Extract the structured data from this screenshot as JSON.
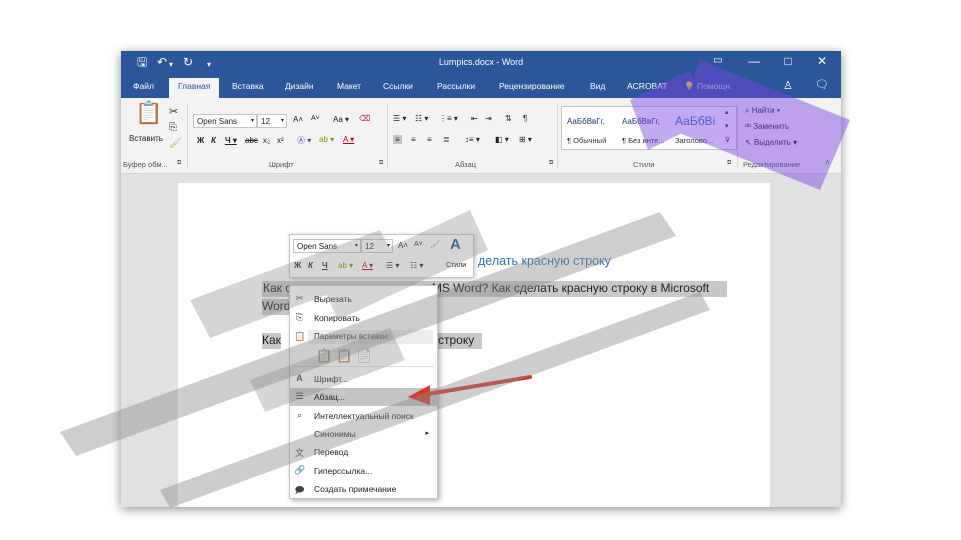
{
  "window": {
    "title": "Lumpics.docx - Word",
    "icons": {
      "save": "save-icon",
      "undo": "undo-icon",
      "redo": "redo-icon",
      "customize": "customize-icon"
    },
    "controls": {
      "ribbon_options": "▭",
      "minimize": "—",
      "maximize": "□",
      "close": "✕"
    }
  },
  "menu": {
    "items": [
      "Файл",
      "Главная",
      "Вставка",
      "Дизайн",
      "Макет",
      "Ссылки",
      "Рассылки",
      "Рецензирование",
      "Вид",
      "ACROBAT"
    ],
    "active": "Главная",
    "help": "Помощн"
  },
  "ribbon": {
    "clipboard": {
      "paste": "Вставить",
      "label": "Буфер обм..."
    },
    "font": {
      "name": "Open Sans",
      "size": "12",
      "label": "Шрифт"
    },
    "paragraph": {
      "label": "Абзац"
    },
    "styles": {
      "label": "Стили",
      "previews": [
        "АаБбВвГг,",
        "АаБбВвГг,",
        "АаБбВі"
      ],
      "names": [
        "¶ Обычный",
        "¶ Без инте...",
        "Заголово..."
      ]
    },
    "editing": {
      "label": "Редактирование",
      "find": "Найти",
      "replace": "Заменить",
      "select": "Выделить"
    }
  },
  "document": {
    "heading": "делать красную строку",
    "line1": "Как сделать красную строку в MS Word? Как сделать красную строку в Microsoft",
    "line2": "Word",
    "line3_start": "Как",
    "line3_end": "строку"
  },
  "mini_toolbar": {
    "font": "Open Sans",
    "size": "12",
    "styles": "Стили"
  },
  "context_menu": {
    "items": [
      {
        "icon": "cut-icon",
        "label": "Вырезать"
      },
      {
        "icon": "copy-icon",
        "label": "Копировать"
      },
      {
        "icon": "paste-options-icon",
        "label": "Параметры вставки:"
      },
      {
        "icon": "font-icon",
        "label": "Шрифт..."
      },
      {
        "icon": "paragraph-icon",
        "label": "Абзац..."
      },
      {
        "icon": "smart-lookup-icon",
        "label": "Интеллектуальный поиск"
      },
      {
        "icon": "synonyms-icon",
        "label": "Синонимы"
      },
      {
        "icon": "translate-icon",
        "label": "Перевод"
      },
      {
        "icon": "hyperlink-icon",
        "label": "Гиперссылка..."
      },
      {
        "icon": "comment-icon",
        "label": "Создать примечание"
      }
    ],
    "highlighted": "Абзац..."
  },
  "colors": {
    "title_bar": "#2b579a",
    "ribbon": "#f3f3f3",
    "arrow": "#d23c2a",
    "heading": "#2e74b5"
  }
}
